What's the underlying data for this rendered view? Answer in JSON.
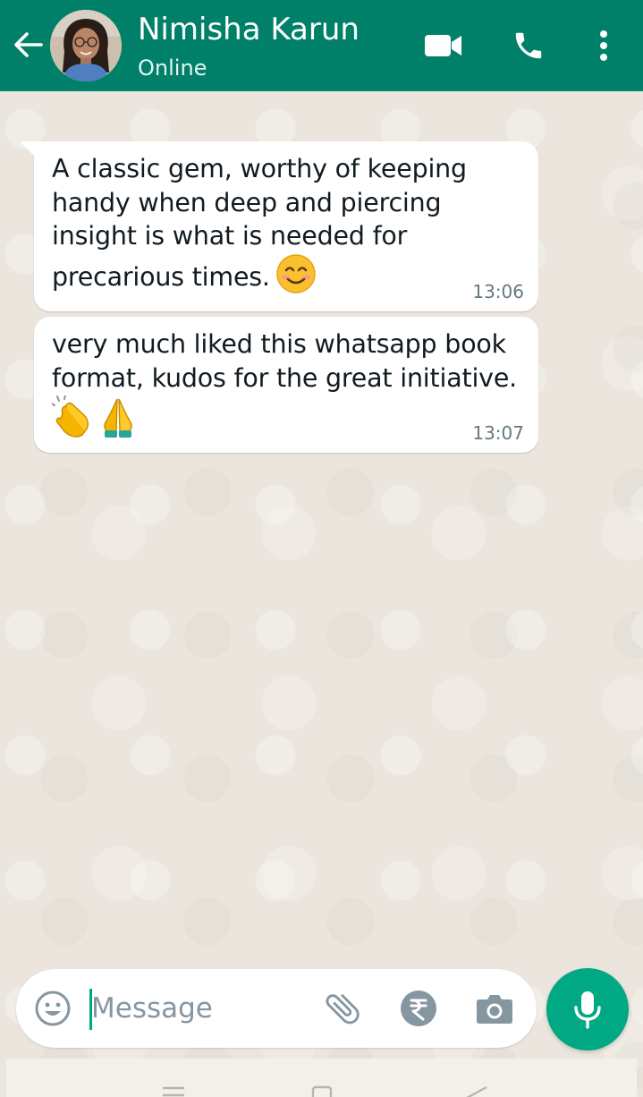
{
  "header": {
    "contact_name": "Nimisha Karun",
    "status": "Online",
    "background_color": "#008069",
    "icons": {
      "back": "arrow-left-icon",
      "video": "video-call-icon",
      "call": "phone-icon",
      "more": "more-vertical-icon"
    }
  },
  "messages": [
    {
      "text": "A classic gem, worthy of keeping handy when deep and piercing insight is what is needed for precarious times.",
      "emoji": "smiling-face-icon",
      "time": "13:06"
    },
    {
      "text": "very much liked this whatsapp book format, kudos for the great initiative.",
      "emojis": [
        "clapping-hands-icon",
        "folded-hands-icon"
      ],
      "time": "13:07"
    }
  ],
  "composer": {
    "placeholder": "Message",
    "value": "",
    "icons": [
      "emoji-icon",
      "attachment-icon",
      "rupee-payment-icon",
      "camera-icon"
    ],
    "send_icon": "microphone-icon",
    "accent_color": "#00a884"
  },
  "navigation_bar": {
    "icons": [
      "recent-apps-icon",
      "home-icon",
      "back-triangle-icon"
    ]
  }
}
